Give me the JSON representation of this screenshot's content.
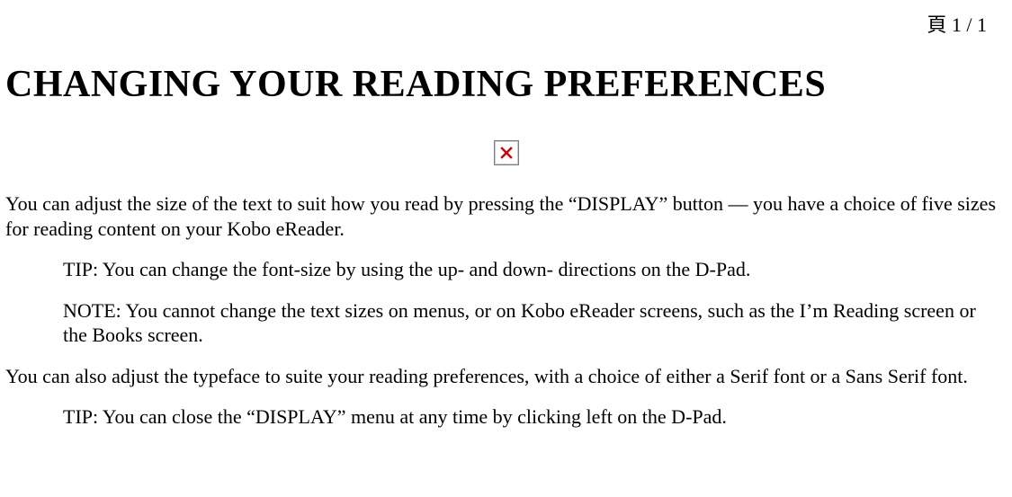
{
  "page_indicator": "頁 1 / 1",
  "title": "CHANGING YOUR READING PREFERENCES",
  "broken_image_alt": "broken-image",
  "paragraphs": {
    "intro": "You can adjust the size of the text to suit how you read by pressing the “DISPLAY” button — you have a choice of five sizes for reading content on your Kobo eReader.",
    "tip1": "TIP: You can change the font-size by using the up- and down- directions on the D-Pad.",
    "note": "NOTE: You cannot change the text sizes on menus, or on Kobo eReader screens, such as the I’m Reading screen or the Books screen.",
    "typeface": "You can also adjust the typeface to suite your reading preferences, with a choice of either a Serif font or a Sans Serif font.",
    "tip2": "TIP: You can close the “DISPLAY” menu at any time by clicking left on the D-Pad."
  }
}
